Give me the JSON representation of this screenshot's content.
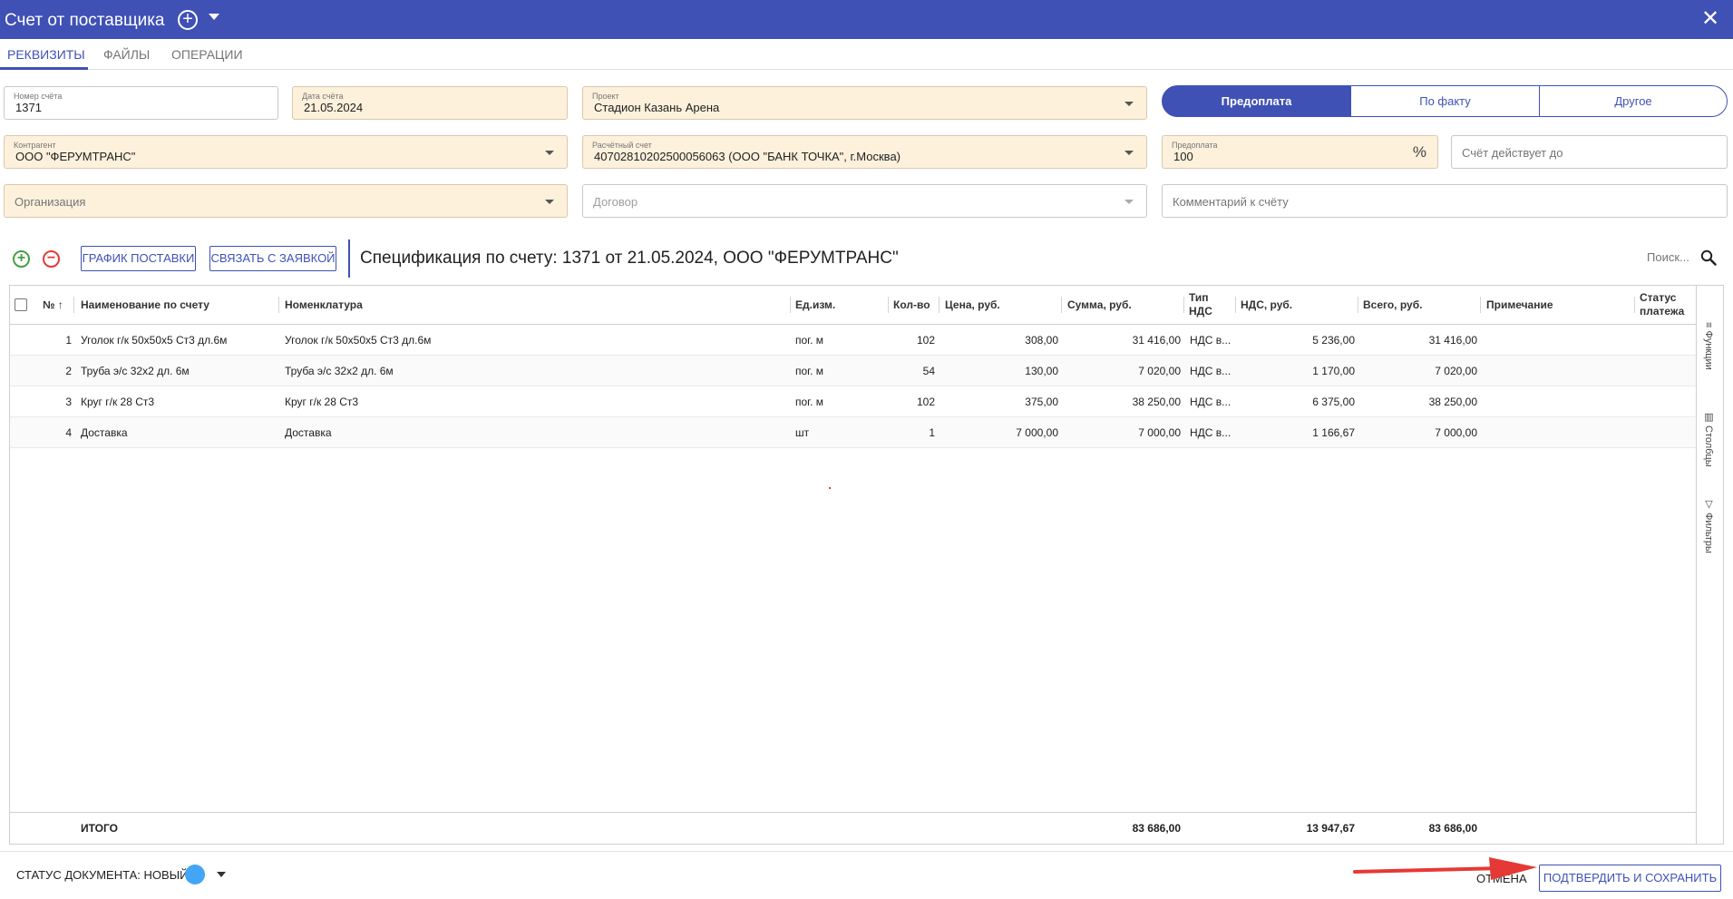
{
  "window": {
    "title": "Счет от поставщика",
    "close_glyph": "✕",
    "add_glyph": "+"
  },
  "tabs": [
    {
      "label": "РЕКВИЗИТЫ",
      "active": true
    },
    {
      "label": "ФАЙЛЫ",
      "active": false
    },
    {
      "label": "ОПЕРАЦИИ",
      "active": false
    }
  ],
  "form": {
    "invoice_number": {
      "label": "Номер счёта",
      "value": "1371"
    },
    "invoice_date": {
      "label": "Дата счёта",
      "value": "21.05.2024"
    },
    "project": {
      "label": "Проект",
      "value": "Стадион Казань Арена"
    },
    "payment_type": {
      "options": [
        "Предоплата",
        "По факту",
        "Другое"
      ],
      "selected": "Предоплата"
    },
    "counterparty": {
      "label": "Контрагент",
      "value": "ООО \"ФЕРУМТРАНС\""
    },
    "account": {
      "label": "Расчётный счет",
      "value": "40702810202500056063 (ООО \"БАНК ТОЧКА\", г.Москва)"
    },
    "prepayment": {
      "label": "Предоплата",
      "value": "100",
      "suffix": "%"
    },
    "valid_until": {
      "placeholder": "Счёт действует до"
    },
    "organization": {
      "placeholder": "Организация"
    },
    "contract": {
      "placeholder": "Договор"
    },
    "comment": {
      "placeholder": "Комментарий к счёту"
    }
  },
  "toolbar": {
    "add_glyph": "+",
    "remove_glyph": "−",
    "schedule_label": "ГРАФИК ПОСТАВКИ",
    "link_label": "СВЯЗАТЬ С ЗАЯВКОЙ",
    "spec_title": "Спецификация по счету: 1371 от 21.05.2024, ООО \"ФЕРУМТРАНС\"",
    "search_label": "Поиск..."
  },
  "table": {
    "columns": {
      "num": "№ ↑",
      "name": "Наименование по счету",
      "nomenclature": "Номенклатура",
      "unit": "Ед.изм.",
      "qty": "Кол-во",
      "price": "Цена, руб.",
      "sum": "Сумма, руб.",
      "vat_type_1": "Тип",
      "vat_type_2": "НДС",
      "vat": "НДС, руб.",
      "total": "Всего, руб.",
      "note": "Примечание",
      "pay_status_1": "Статус",
      "pay_status_2": "платежа"
    },
    "rows": [
      {
        "num": "1",
        "name": "Уголок г/к 50х50х5 Ст3 дл.6м",
        "nomenclature": "Уголок г/к 50х50х5 Ст3 дл.6м",
        "unit": "пог. м",
        "qty": "102",
        "price": "308,00",
        "sum": "31 416,00",
        "vat_type": "НДС в...",
        "vat": "5 236,00",
        "total": "31 416,00"
      },
      {
        "num": "2",
        "name": "Труба э/с 32х2 дл. 6м",
        "nomenclature": "Труба э/с 32х2 дл. 6м",
        "unit": "пог. м",
        "qty": "54",
        "price": "130,00",
        "sum": "7 020,00",
        "vat_type": "НДС в...",
        "vat": "1 170,00",
        "total": "7 020,00"
      },
      {
        "num": "3",
        "name": "Круг г/к 28 Ст3",
        "nomenclature": "Круг г/к 28 Ст3",
        "unit": "пог. м",
        "qty": "102",
        "price": "375,00",
        "sum": "38 250,00",
        "vat_type": "НДС в...",
        "vat": "6 375,00",
        "total": "38 250,00"
      },
      {
        "num": "4",
        "name": "Доставка",
        "nomenclature": "Доставка",
        "unit": "шт",
        "qty": "1",
        "price": "7 000,00",
        "sum": "7 000,00",
        "vat_type": "НДС в...",
        "vat": "1 166,67",
        "total": "7 000,00"
      }
    ],
    "footer": {
      "label": "ИТОГО",
      "sum": "83 686,00",
      "vat": "13 947,67",
      "total": "83 686,00"
    }
  },
  "side_panel": {
    "functions": "≡ Функции",
    "columns": "▥ Столбцы",
    "filters": "▽ Фильтры"
  },
  "bottom": {
    "status_label": "СТАТУС ДОКУМЕНТА: НОВЫЙ",
    "status_color": "#42a5f5",
    "cancel_label": "ОТМЕНА",
    "save_label": "ПОДТВЕРДИТЬ И СОХРАНИТЬ",
    "arrow_color": "#e53935"
  },
  "colors": {
    "accent": "#3f51b5",
    "required_field": "#fdf1dc"
  }
}
